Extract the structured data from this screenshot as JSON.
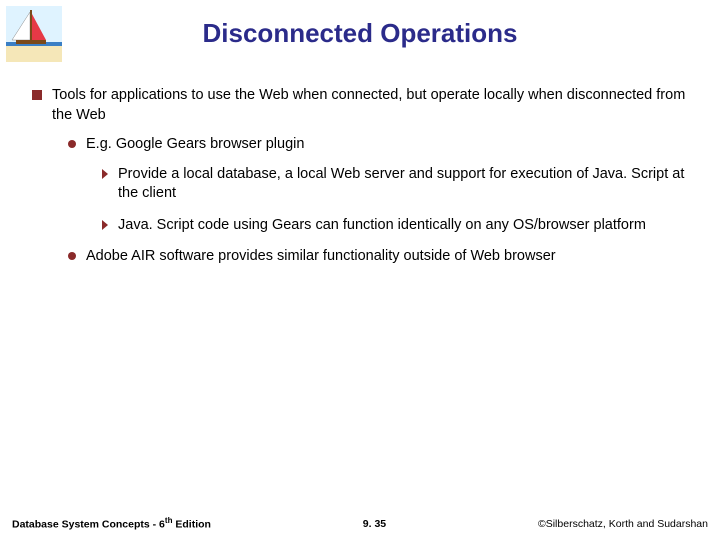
{
  "title": "Disconnected Operations",
  "logo": {
    "name": "sailboat-logo"
  },
  "bullets": {
    "b1": "Tools for applications to use the Web when connected, but operate locally when disconnected from the Web",
    "b1a": "E.g. Google Gears browser plugin",
    "b1a1": "Provide a local database, a local Web server and support for execution of Java. Script at the client",
    "b1a2": "Java. Script code using Gears can function identically on any OS/browser platform",
    "b1b": "Adobe AIR software provides similar functionality outside of Web browser"
  },
  "footer": {
    "left_prefix": "Database System Concepts - 6",
    "left_sup": "th",
    "left_suffix": " Edition",
    "center": "9. 35",
    "right": "©Silberschatz, Korth and Sudarshan"
  }
}
